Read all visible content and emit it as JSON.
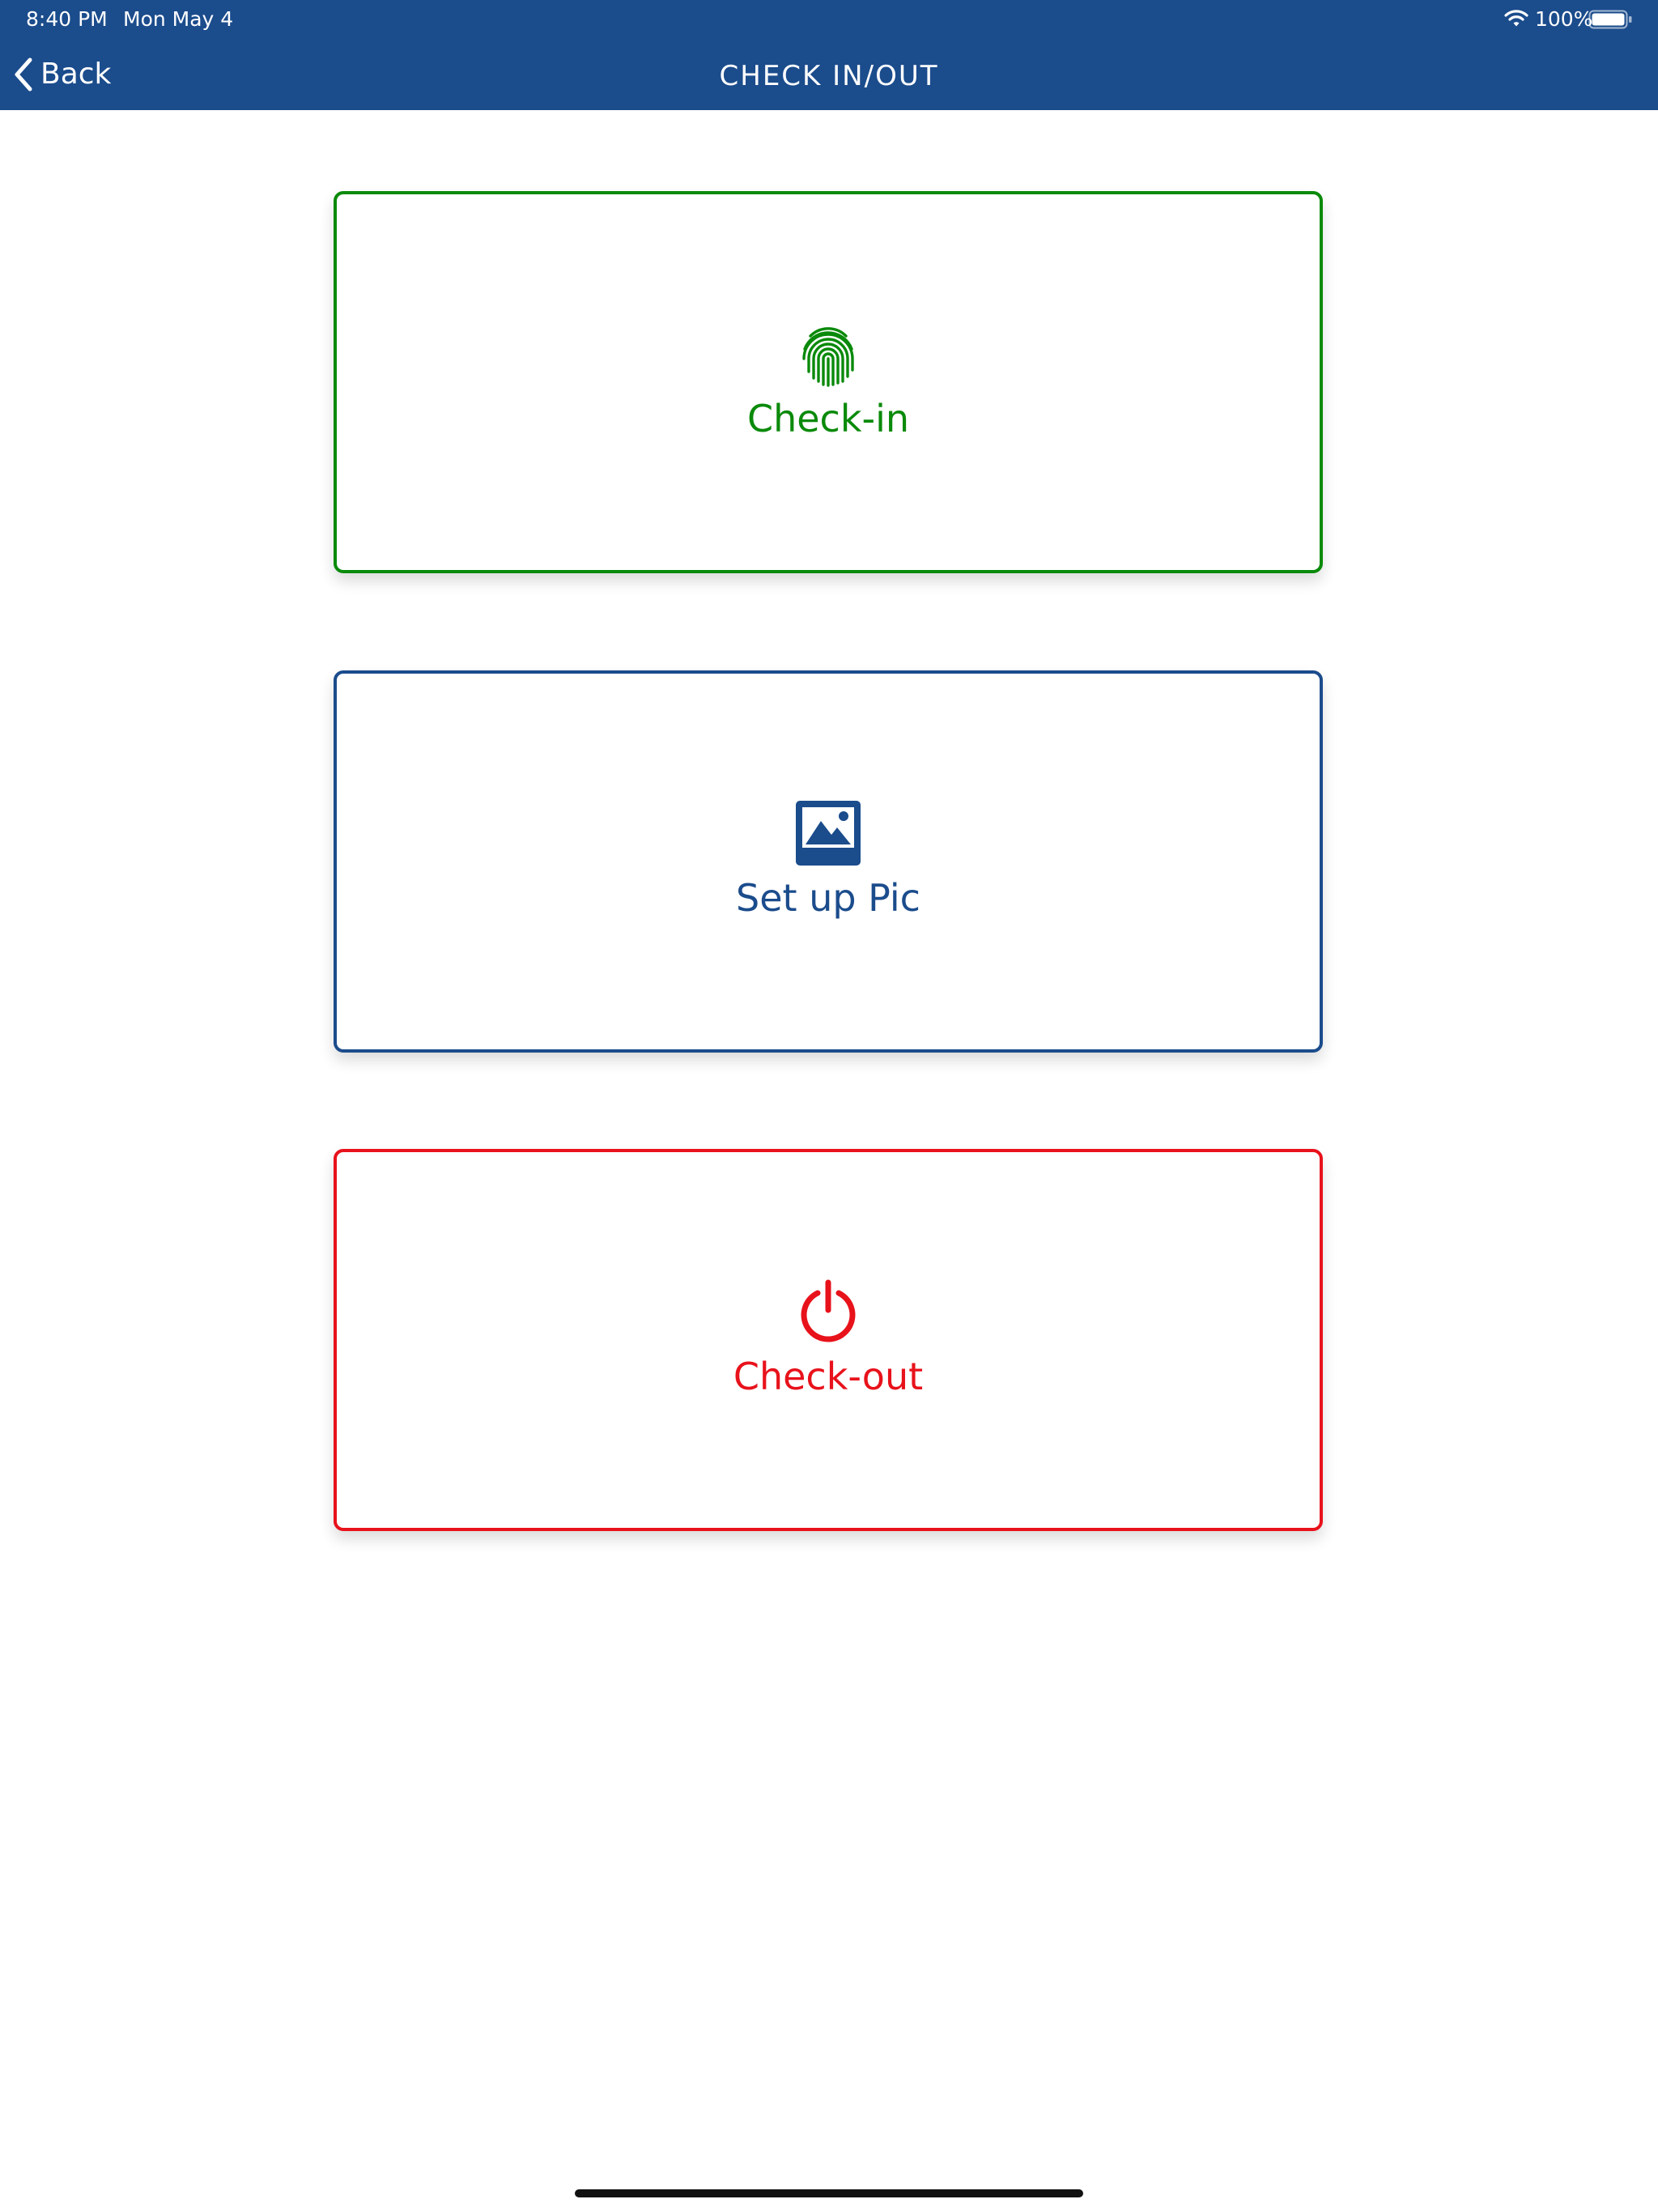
{
  "status_bar": {
    "time": "8:40 PM",
    "date": "Mon May 4",
    "battery": "100%",
    "wifi_icon": "wifi-icon",
    "battery_icon": "battery-icon"
  },
  "nav_bar": {
    "back_label": "Back",
    "back_icon": "chevron-left-icon",
    "title": "CHECK IN/OUT",
    "background": "#1b4c8c"
  },
  "actions": [
    {
      "label": "Check-in",
      "icon": "fingerprint-icon",
      "color": "#0a8a0a"
    },
    {
      "label": "Set up Pic",
      "icon": "image-icon",
      "color": "#1b4c8c"
    },
    {
      "label": "Check-out",
      "icon": "power-icon",
      "color": "#e8121b"
    }
  ]
}
